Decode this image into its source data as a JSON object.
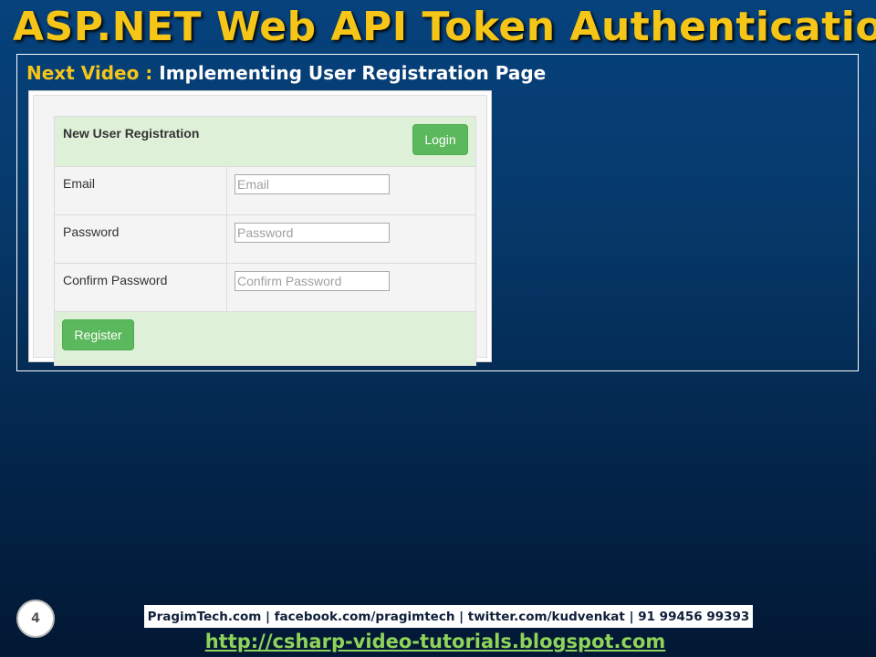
{
  "slide": {
    "title": "ASP.NET Web API Token Authentication",
    "next_label": "Next Video :",
    "next_topic": "Implementing User Registration Page",
    "page_number": "4",
    "contacts": "PragimTech.com | facebook.com/pragimtech  | twitter.com/kudvenkat  | 91 99456 99393",
    "url": "http://csharp-video-tutorials.blogspot.com"
  },
  "form": {
    "heading": "New User Registration",
    "login_label": "Login",
    "register_label": "Register",
    "fields": [
      {
        "label": "Email",
        "placeholder": "Email"
      },
      {
        "label": "Password",
        "placeholder": "Password"
      },
      {
        "label": "Confirm Password",
        "placeholder": "Confirm Password"
      }
    ]
  },
  "colors": {
    "title": "#f5c518",
    "background": "#063a6c",
    "panel_green": "#dff0d8",
    "button_green": "#5cb85c",
    "url_green": "#8fd35a"
  }
}
